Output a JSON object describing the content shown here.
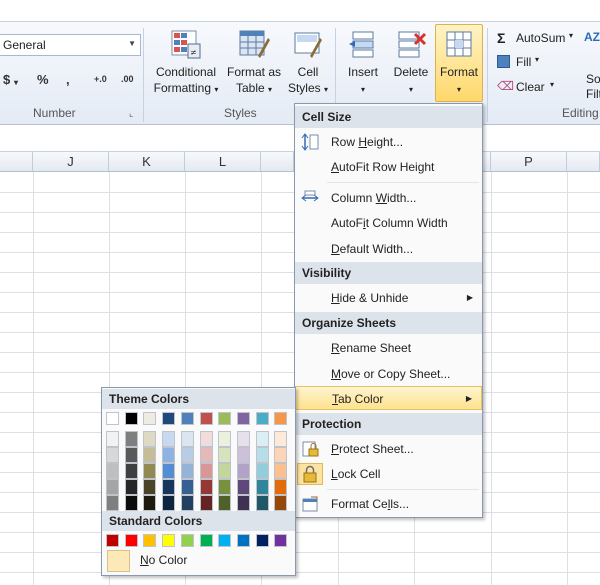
{
  "ribbon": {
    "number_format": "General",
    "number_buttons": [
      "$",
      "%",
      ",",
      "+.0",
      ".00"
    ],
    "group_number": "Number",
    "group_styles": "Styles",
    "group_editing": "Editing",
    "conditional_formatting": [
      "Conditional",
      "Formatting"
    ],
    "format_as_table": [
      "Format as",
      "Table"
    ],
    "cell_styles": [
      "Cell",
      "Styles"
    ],
    "insert": "Insert",
    "delete": "Delete",
    "format": "Format",
    "autosum": "AutoSum",
    "fill": "Fill",
    "clear": "Clear",
    "sort_partial": [
      "So",
      "Filt"
    ]
  },
  "columns": [
    "J",
    "K",
    "L",
    "P"
  ],
  "menu": {
    "cell_size": "Cell Size",
    "row_height": "Row Height...",
    "autofit_row_height": "AutoFit Row Height",
    "column_width": "Column Width...",
    "autofit_column_width": "AutoFit Column Width",
    "default_width": "Default Width...",
    "visibility": "Visibility",
    "hide_unhide": "Hide & Unhide",
    "organize_sheets": "Organize Sheets",
    "rename_sheet": "Rename Sheet",
    "move_copy_sheet": "Move or Copy Sheet...",
    "tab_color": "Tab Color",
    "protection": "Protection",
    "protect_sheet": "Protect Sheet...",
    "lock_cell": "Lock Cell",
    "format_cells": "Format Cells..."
  },
  "palette": {
    "theme_colors": "Theme Colors",
    "standard_colors": "Standard Colors",
    "no_color": "No Color",
    "theme_rows": [
      [
        "#ffffff",
        "#000000",
        "#eeece1",
        "#1f497d",
        "#4f81bd",
        "#c0504d",
        "#9bbb59",
        "#8064a2",
        "#4bacc6",
        "#f79646"
      ],
      [
        "#f2f2f2",
        "#7f7f7f",
        "#ddd9c3",
        "#c6d9f0",
        "#dbe5f1",
        "#f2dcdb",
        "#ebf1dd",
        "#e5e0ec",
        "#dbeef3",
        "#fdeada"
      ],
      [
        "#d8d8d8",
        "#595959",
        "#c4bd97",
        "#8db3e2",
        "#b8cce4",
        "#e5b9b7",
        "#d7e3bc",
        "#ccc1d9",
        "#b7dde8",
        "#fbd5b5"
      ],
      [
        "#bfbfbf",
        "#3f3f3f",
        "#938953",
        "#548dd4",
        "#95b3d7",
        "#d99694",
        "#c3d69b",
        "#b2a2c7",
        "#92cddc",
        "#fac08f"
      ],
      [
        "#a5a5a5",
        "#262626",
        "#494429",
        "#17365d",
        "#366092",
        "#953734",
        "#76923c",
        "#5f497a",
        "#31859b",
        "#e36c09"
      ],
      [
        "#7f7f7f",
        "#0c0c0c",
        "#1d1b10",
        "#0f243e",
        "#244061",
        "#632423",
        "#4f6128",
        "#3f3151",
        "#205867",
        "#974806"
      ]
    ],
    "standard": [
      "#c00000",
      "#ff0000",
      "#ffc000",
      "#ffff00",
      "#92d050",
      "#00b050",
      "#00b0f0",
      "#0070c0",
      "#002060",
      "#7030a0"
    ]
  }
}
